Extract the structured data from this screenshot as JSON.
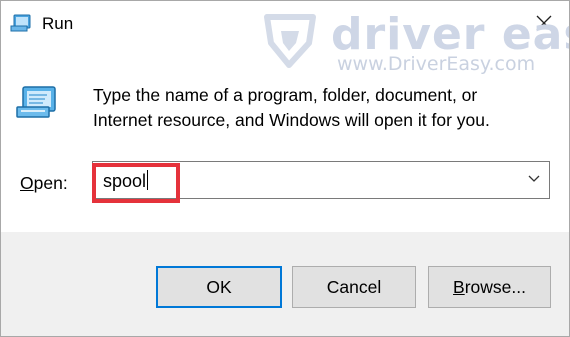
{
  "window": {
    "title": "Run",
    "icon": "run-icon",
    "close_icon": "close-icon"
  },
  "watermark": {
    "brand": "driver easy",
    "url": "www.DriverEasy.com"
  },
  "message": {
    "line1": "Type the name of a program, folder, document, or",
    "line2": "Internet resource, and Windows will open it for you."
  },
  "open": {
    "label_accel": "O",
    "label_rest": "pen:",
    "value": "spool",
    "dropdown_icon": "chevron-down-icon"
  },
  "buttons": {
    "ok": "OK",
    "cancel": "Cancel",
    "browse_accel": "B",
    "browse_rest": "rowse..."
  },
  "colors": {
    "highlight": "#e5323b",
    "focus": "#0078d7",
    "footer": "#f0f0f0"
  }
}
